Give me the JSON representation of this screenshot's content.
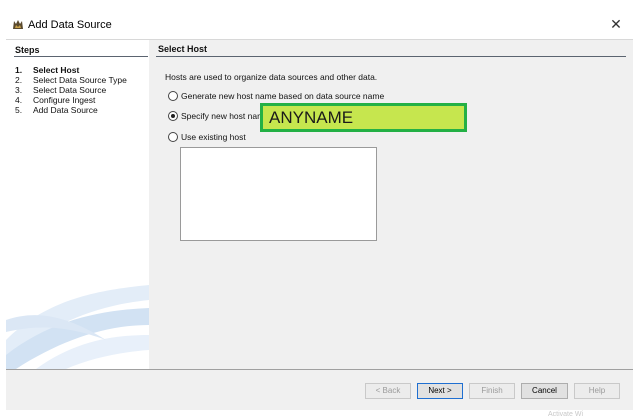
{
  "window": {
    "title": "Add Data Source",
    "close_glyph": "✕"
  },
  "steps": {
    "heading": "Steps",
    "items": [
      {
        "num": "1.",
        "label": "Select Host"
      },
      {
        "num": "2.",
        "label": "Select Data Source Type"
      },
      {
        "num": "3.",
        "label": "Select Data Source"
      },
      {
        "num": "4.",
        "label": "Configure Ingest"
      },
      {
        "num": "5.",
        "label": "Add Data Source"
      }
    ],
    "active_index": 0
  },
  "panel": {
    "heading": "Select Host",
    "intro": "Hosts are used to organize data sources and other data.",
    "options": [
      {
        "label": "Generate new host name based on data source name",
        "checked": false
      },
      {
        "label": "Specify new host name",
        "checked": true
      },
      {
        "label": "Use existing host",
        "checked": false
      }
    ],
    "host_name_value": "ANYNAME"
  },
  "buttons": {
    "back": "< Back",
    "next": "Next >",
    "finish": "Finish",
    "cancel": "Cancel",
    "help": "Help"
  },
  "watermark": "Activate Wi",
  "colors": {
    "highlight_border": "#23b045",
    "highlight_fill": "#c6e64e"
  },
  "icons": {
    "app": "autopsy-dog-icon",
    "close": "close-icon"
  }
}
